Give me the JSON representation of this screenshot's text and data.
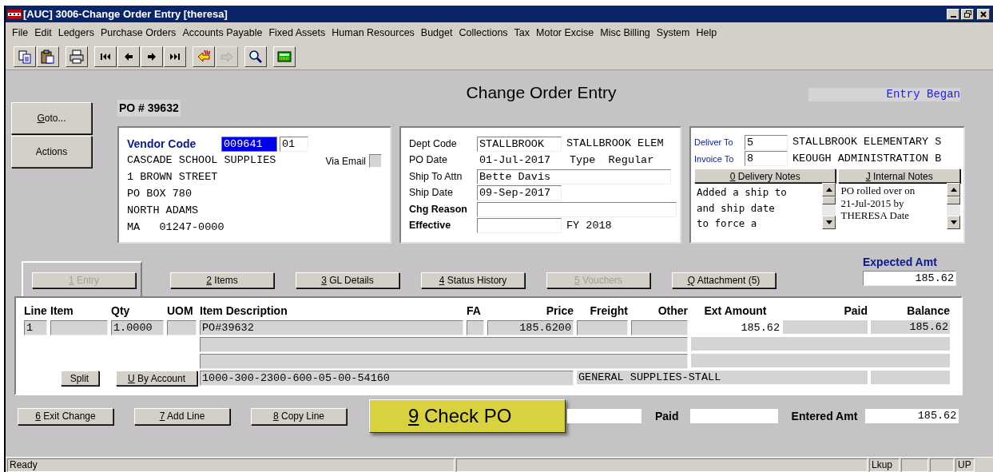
{
  "window": {
    "title": "[AUC] 3006-Change Order Entry [theresa]"
  },
  "menu": [
    "File",
    "Edit",
    "Ledgers",
    "Purchase Orders",
    "Accounts Payable",
    "Fixed Assets",
    "Human Resources",
    "Budget",
    "Collections",
    "Tax",
    "Motor Excise",
    "Misc Billing",
    "System",
    "Help"
  ],
  "toolbar": [
    [
      {
        "kind": "copy",
        "disabled": false
      },
      {
        "kind": "paste",
        "disabled": false
      }
    ],
    [
      {
        "kind": "print",
        "disabled": false
      }
    ],
    [
      {
        "kind": "first",
        "disabled": false
      },
      {
        "kind": "previous",
        "disabled": false
      },
      {
        "kind": "next",
        "disabled": false
      },
      {
        "kind": "last",
        "disabled": false
      }
    ],
    [
      {
        "kind": "point-back",
        "disabled": false
      },
      {
        "kind": "point-forward",
        "disabled": true
      }
    ],
    [
      {
        "kind": "search",
        "disabled": false
      }
    ],
    [
      {
        "kind": "calculator",
        "disabled": false
      }
    ]
  ],
  "side_buttons": [
    {
      "label": "Goto...",
      "hotkey": true
    },
    {
      "label": "Actions",
      "hotkey": false
    }
  ],
  "po_number": "PO # 39632",
  "heading": "Change Order Entry",
  "entry_status": "Entry Began",
  "vendor": {
    "label": "Vendor Code",
    "code": "009641",
    "suffix": "01",
    "via_email_label": "Via Email",
    "via_email": false,
    "address": [
      "CASCADE SCHOOL SUPPLIES",
      "1 BROWN STREET",
      "PO BOX 780",
      "NORTH ADAMS",
      "MA   01247-0000"
    ]
  },
  "order_fields": [
    {
      "label": "Dept Code",
      "kind": "field",
      "emphasized": false,
      "value": "STALLBROOK",
      "extra": "STALLBROOK ELEM"
    },
    {
      "label": "PO Date",
      "kind": "text",
      "emphasized": false,
      "value": "01-Jul-2017",
      "extra": "Type  Regular"
    },
    {
      "label": "Ship To Attn",
      "kind": "wide",
      "emphasized": false,
      "value": "Bette Davis"
    },
    {
      "label": "Ship Date",
      "kind": "field",
      "emphasized": false,
      "value": "09-Sep-2017"
    },
    {
      "label": "Chg Reason",
      "kind": "wide",
      "emphasized": true
    },
    {
      "label": "Effective",
      "kind": "field",
      "emphasized": true,
      "extra": "FY 2018"
    }
  ],
  "delivery": {
    "deliver_label": "Deliver To",
    "deliver_code": "5",
    "deliver_name": "STALLBROOK ELEMENTARY S",
    "invoice_label": "Invoice To",
    "invoice_code": "8",
    "invoice_name": "KEOUGH ADMINISTRATION B",
    "notes": [
      {
        "button": "0 Delivery Notes",
        "kind": "mono",
        "lines": [
          "Added a ship to",
          "and ship date",
          "to force a"
        ]
      },
      {
        "button": "J Internal Notes",
        "kind": "serif",
        "lines": [
          "PO rolled over on",
          "21-Jul-2015 by",
          "THERESA Date"
        ]
      }
    ]
  },
  "tabs": [
    {
      "label": "1 Entry",
      "selected": true,
      "disabled": true
    },
    {
      "label": "2 Items",
      "selected": false,
      "disabled": false
    },
    {
      "label": "3 GL Details",
      "selected": false,
      "disabled": false
    },
    {
      "label": "4 Status History",
      "selected": false,
      "disabled": false
    },
    {
      "label": "5 Vouchers",
      "selected": false,
      "disabled": true
    },
    {
      "label": "Q Attachment (5)",
      "selected": false,
      "disabled": false
    }
  ],
  "expected": {
    "label": "Expected Amt",
    "value": "185.62"
  },
  "grid": {
    "columns": [
      "Line",
      "Item",
      "Qty",
      "UOM",
      "Item Description",
      "FA",
      "Price",
      "Freight",
      "Other",
      "Ext Amount",
      "Paid",
      "Balance"
    ],
    "row": {
      "line": "1",
      "qty": "1.0000",
      "description": "PO#39632",
      "price": "185.6200",
      "ext_amount": "185.62",
      "balance": "185.62"
    },
    "split_button": "Split",
    "account_button": "U By Account",
    "account": "1000-300-2300-600-05-00-54160",
    "account_name": "GENERAL SUPPLIES-STALL"
  },
  "actions": [
    {
      "label": "6 Exit Change",
      "kind": "normal"
    },
    {
      "label": "7 Add Line",
      "kind": "normal"
    },
    {
      "label": "8 Copy Line",
      "kind": "normal"
    },
    {
      "label": "9 Check PO",
      "kind": "highlight"
    }
  ],
  "totals": {
    "paid_label": "Paid",
    "entered_label": "Entered Amt",
    "entered": "185.62"
  },
  "status_bar": {
    "message": "Ready",
    "lookup": "Lkup",
    "mode": "UP"
  }
}
